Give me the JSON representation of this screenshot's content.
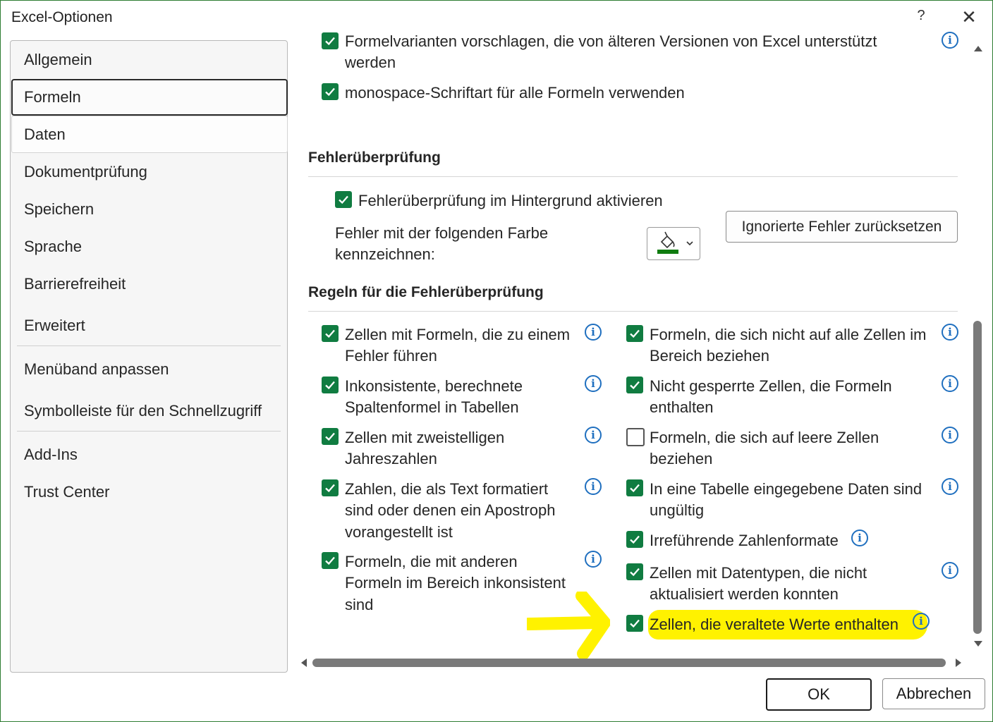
{
  "window": {
    "title": "Excel-Optionen",
    "help": "?",
    "close": "✕"
  },
  "sidebar": {
    "items": [
      "Allgemein",
      "Formeln",
      "Daten",
      "Dokumentprüfung",
      "Speichern",
      "Sprache",
      "Barrierefreiheit",
      "Erweitert",
      "Menüband anpassen",
      "Symbolleiste für den Schnellzugriff",
      "Add-Ins",
      "Trust Center"
    ],
    "selected": "Formeln"
  },
  "top": {
    "opt1_line1": "Formelvarianten vorschlagen, die von älteren Versionen von Excel unterstützt",
    "opt1_line2": "werden",
    "opt2": "monospace-Schriftart für alle Formeln verwenden"
  },
  "errorcheck": {
    "heading": "Fehlerüberprüfung",
    "enable": "Fehlerüberprüfung im Hintergrund aktivieren",
    "color_label_line1": "Fehler mit der folgenden Farbe",
    "color_label_line2": "kennzeichnen:",
    "color": "#107c10",
    "reset_button": "Ignorierte Fehler zurücksetzen"
  },
  "rules": {
    "heading": "Regeln für die Fehlerüberprüfung",
    "left": [
      {
        "lines": [
          "Zellen mit Formeln, die zu einem",
          "Fehler führen"
        ],
        "checked": true
      },
      {
        "lines": [
          "Inkonsistente, berechnete",
          "Spaltenformel in Tabellen"
        ],
        "checked": true
      },
      {
        "lines": [
          "Zellen mit zweistelligen",
          "Jahreszahlen"
        ],
        "checked": true
      },
      {
        "lines": [
          "Zahlen, die als Text formatiert",
          "sind oder denen ein Apostroph",
          "vorangestellt ist"
        ],
        "checked": true
      },
      {
        "lines": [
          "Formeln, die mit anderen",
          "Formeln im Bereich inkonsistent",
          "sind"
        ],
        "checked": true
      }
    ],
    "right": [
      {
        "lines": [
          "Formeln, die sich nicht auf alle Zellen im",
          "Bereich beziehen"
        ],
        "checked": true
      },
      {
        "lines": [
          "Nicht gesperrte Zellen, die Formeln",
          "enthalten"
        ],
        "checked": true
      },
      {
        "lines": [
          "Formeln, die sich auf leere Zellen",
          "beziehen"
        ],
        "checked": false
      },
      {
        "lines": [
          "In eine Tabelle eingegebene Daten sind",
          "ungültig"
        ],
        "checked": true
      },
      {
        "lines": [
          "Irreführende Zahlenformate"
        ],
        "checked": true
      },
      {
        "lines": [
          "Zellen mit Datentypen, die nicht",
          "aktualisiert werden konnten"
        ],
        "checked": true
      },
      {
        "lines": [
          "Zellen, die veraltete Werte enthalten"
        ],
        "checked": true
      }
    ]
  },
  "buttons": {
    "ok": "OK",
    "cancel": "Abbrechen"
  },
  "colors": {
    "checkbox": "#107c41",
    "highlight": "#fff200",
    "info": "#1f6fbf"
  }
}
